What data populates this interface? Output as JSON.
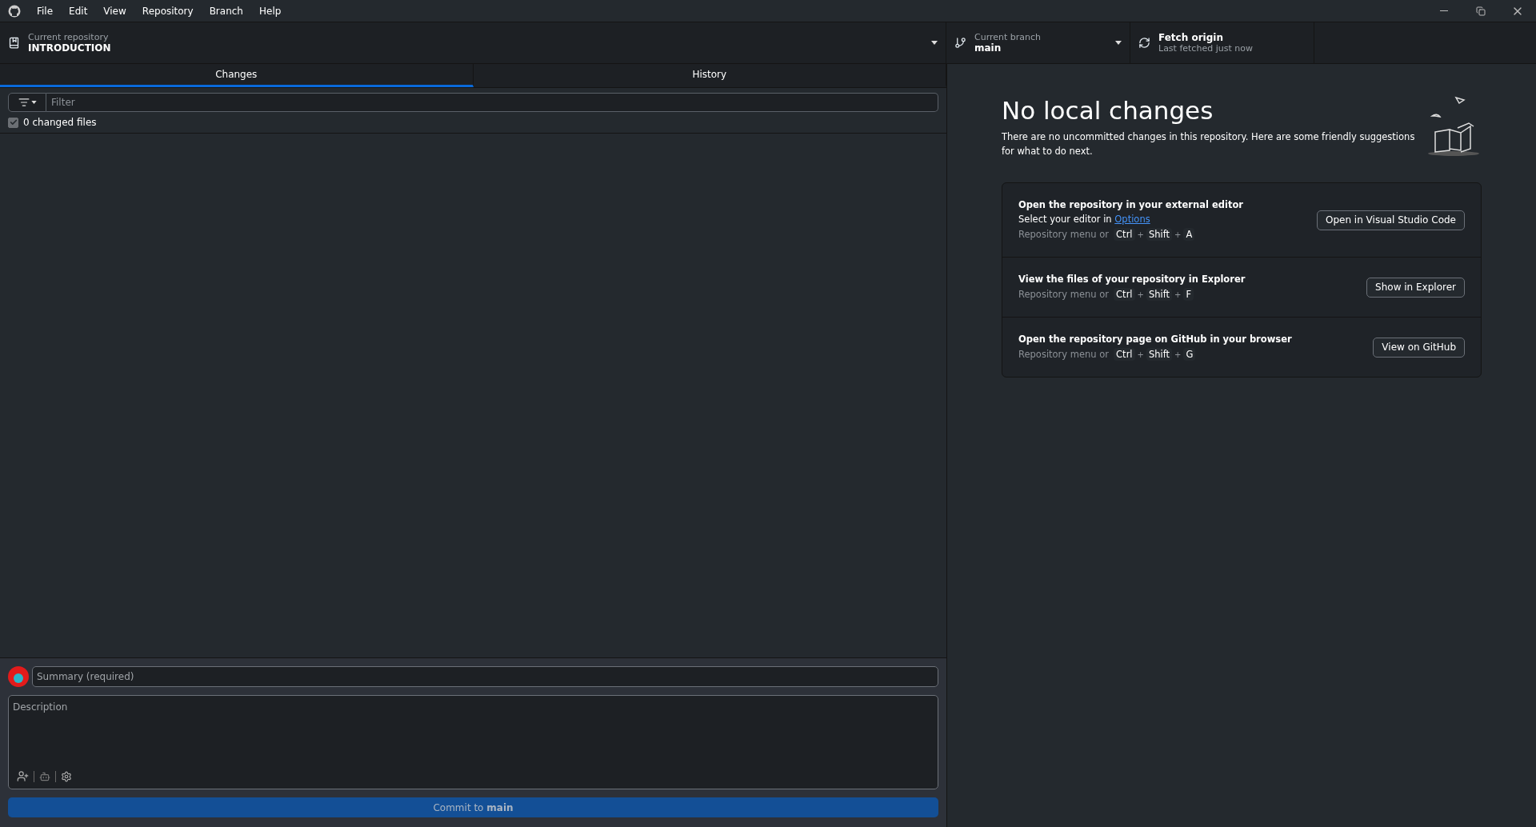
{
  "menu": [
    "File",
    "Edit",
    "View",
    "Repository",
    "Branch",
    "Help"
  ],
  "toolbar": {
    "repository": {
      "label": "Current repository",
      "value": "INTRODUCTION"
    },
    "branch": {
      "label": "Current branch",
      "value": "main"
    },
    "fetch": {
      "label": "Fetch origin",
      "value": "Last fetched just now"
    }
  },
  "tabs": [
    {
      "label": "Changes",
      "selected": true
    },
    {
      "label": "History",
      "selected": false
    }
  ],
  "filter": {
    "placeholder": "Filter"
  },
  "changed_files": {
    "label": "0 changed files",
    "checked": true
  },
  "commit": {
    "summary_placeholder": "Summary (required)",
    "description_placeholder": "Description",
    "button": "Commit to **main**"
  },
  "empty_state": {
    "title": "No local changes",
    "text": "There are no uncommitted changes in this repository. Here are some friendly suggestions for what to do next.",
    "suggestions": [
      {
        "title": "Open the repository in your external editor",
        "hint": "Select your editor in",
        "link": "Options",
        "shortcut_prefix": "Repository menu or",
        "keys": [
          {
            "kind": "key",
            "text": "Ctrl"
          },
          {
            "kind": "plus",
            "text": "+"
          },
          {
            "kind": "key",
            "text": "Shift"
          },
          {
            "kind": "plus",
            "text": "+"
          },
          {
            "kind": "key",
            "text": "A"
          }
        ],
        "button": "Open in Visual Studio Code"
      },
      {
        "title": "View the files of your repository in Explorer",
        "shortcut_prefix": "Repository menu or",
        "keys": [
          {
            "kind": "key",
            "text": "Ctrl"
          },
          {
            "kind": "plus",
            "text": "+"
          },
          {
            "kind": "key",
            "text": "Shift"
          },
          {
            "kind": "plus",
            "text": "+"
          },
          {
            "kind": "key",
            "text": "F"
          }
        ],
        "button": "Show in Explorer"
      },
      {
        "title": "Open the repository page on GitHub in your browser",
        "shortcut_prefix": "Repository menu or",
        "keys": [
          {
            "kind": "key",
            "text": "Ctrl"
          },
          {
            "kind": "plus",
            "text": "+"
          },
          {
            "kind": "key",
            "text": "Shift"
          },
          {
            "kind": "plus",
            "text": "+"
          },
          {
            "kind": "key",
            "text": "G"
          }
        ],
        "button": "View on GitHub"
      }
    ]
  }
}
